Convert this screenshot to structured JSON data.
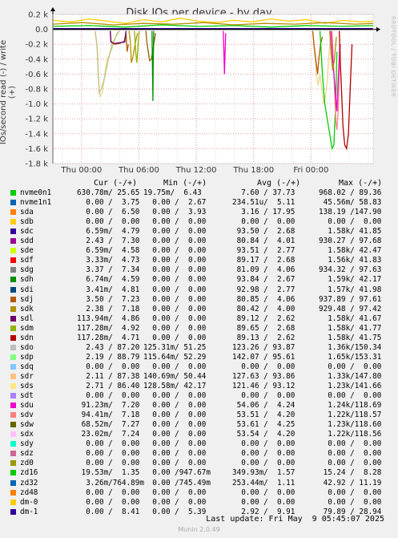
{
  "chart_data": {
    "type": "line",
    "title": "Disk IOs per device - by day",
    "ylabel": "IOs/second read (-) / write (+)",
    "side_label": "RRDTOOL / TOBI OETIKER",
    "ylim": [
      -1.8,
      0.2
    ],
    "y_ticks": [
      "0.2 k",
      "0.0",
      "-0.2 k",
      "-0.4 k",
      "-0.6 k",
      "-0.8 k",
      "-1.0 k",
      "-1.2 k",
      "-1.4 k",
      "-1.6 k",
      "-1.8 k"
    ],
    "x_ticks": [
      "Thu 00:00",
      "Thu 06:00",
      "Thu 12:00",
      "Thu 18:00",
      "Fri 00:00"
    ],
    "x_unit": "hours",
    "xlim": [
      -3,
      30.5
    ],
    "columns": [
      "Cur (-/+)",
      "Min (-/+)",
      "Avg (-/+)",
      "Max (-/+)"
    ],
    "series": [
      {
        "name": "nvme0n1",
        "color": "#00cc00",
        "cur": "630.78m/ 25.65",
        "min": "19.75m/  6.43",
        "avg": "  7.60 / 37.73",
        "max": "968.02 / 89.36"
      },
      {
        "name": "nvme1n1",
        "color": "#0066b3",
        "cur": "  0.00 /  3.75",
        "min": "  0.00 /  2.67",
        "avg": "234.51u/  5.11",
        "max": " 45.56m/ 58.83"
      },
      {
        "name": "sda",
        "color": "#ff8000",
        "cur": "  0.00 /  6.50",
        "min": "  0.00 /  3.93",
        "avg": "  3.16 / 17.95",
        "max": "138.19 /147.90"
      },
      {
        "name": "sdb",
        "color": "#ffcc00",
        "cur": "  0.00 /  0.00",
        "min": "  0.00 /  0.00",
        "avg": "  0.00 /  0.00",
        "max": "  0.00 /  0.00"
      },
      {
        "name": "sdc",
        "color": "#330099",
        "cur": "  6.59m/  4.79",
        "min": "  0.00 /  0.00",
        "avg": " 93.50 /  2.68",
        "max": "  1.58k/ 41.85"
      },
      {
        "name": "sdd",
        "color": "#990099",
        "cur": "  2.43 /  7.30",
        "min": "  0.00 /  0.00",
        "avg": " 80.84 /  4.01",
        "max": "930.27 / 97.68"
      },
      {
        "name": "sde",
        "color": "#ccff00",
        "cur": "  6.59m/  4.58",
        "min": "  0.00 /  0.00",
        "avg": " 93.51 /  2.77",
        "max": "  1.58k/ 42.47"
      },
      {
        "name": "sdf",
        "color": "#ff0000",
        "cur": "  3.33m/  4.73",
        "min": "  0.00 /  0.00",
        "avg": " 89.17 /  2.68",
        "max": "  1.56k/ 41.83"
      },
      {
        "name": "sdg",
        "color": "#808080",
        "cur": "  3.37 /  7.34",
        "min": "  0.00 /  0.00",
        "avg": " 81.09 /  4.06",
        "max": "934.32 / 97.63"
      },
      {
        "name": "sdh",
        "color": "#008f00",
        "cur": "  6.74m/  4.59",
        "min": "  0.00 /  0.00",
        "avg": " 93.84 /  2.67",
        "max": "  1.59k/ 42.17"
      },
      {
        "name": "sdi",
        "color": "#00487d",
        "cur": "  3.41m/  4.81",
        "min": "  0.00 /  0.00",
        "avg": " 92.98 /  2.77",
        "max": "  1.57k/ 41.98"
      },
      {
        "name": "sdj",
        "color": "#b35a00",
        "cur": "  3.50 /  7.23",
        "min": "  0.00 /  0.00",
        "avg": " 80.85 /  4.06",
        "max": "937.89 / 97.61"
      },
      {
        "name": "sdk",
        "color": "#b38f00",
        "cur": "  2.38 /  7.18",
        "min": "  0.00 /  0.00",
        "avg": " 80.42 /  4.00",
        "max": "929.48 / 97.42"
      },
      {
        "name": "sdl",
        "color": "#6b006b",
        "cur": "113.94m/  4.86",
        "min": "  0.00 /  0.00",
        "avg": " 89.12 /  2.62",
        "max": "  1.58k/ 41.67"
      },
      {
        "name": "sdm",
        "color": "#8fb300",
        "cur": "117.28m/  4.92",
        "min": "  0.00 /  0.00",
        "avg": " 89.65 /  2.68",
        "max": "  1.58k/ 41.77"
      },
      {
        "name": "sdn",
        "color": "#b30000",
        "cur": "117.28m/  4.71",
        "min": "  0.00 /  0.00",
        "avg": " 89.13 /  2.62",
        "max": "  1.58k/ 41.75"
      },
      {
        "name": "sdo",
        "color": "#bebebe",
        "cur": "  2.43 / 87.20",
        "min": "125.31m/ 51.25",
        "avg": "123.26 / 93.87",
        "max": "  1.36k/150.34"
      },
      {
        "name": "sdp",
        "color": "#80ff80",
        "cur": "  2.19 / 88.79",
        "min": "115.64m/ 52.29",
        "avg": "142.07 / 95.61",
        "max": "  1.65k/153.31"
      },
      {
        "name": "sdq",
        "color": "#80c9ff",
        "cur": "  0.00 /  0.00",
        "min": "  0.00 /  0.00",
        "avg": "  0.00 /  0.00",
        "max": "  0.00 /  0.00"
      },
      {
        "name": "sdr",
        "color": "#ffc080",
        "cur": "  2.11 / 87.38",
        "min": "140.69m/ 50.44",
        "avg": "127.63 / 93.86",
        "max": "  1.33k/147.80"
      },
      {
        "name": "sds",
        "color": "#ffe680",
        "cur": "  2.71 / 86.40",
        "min": "128.58m/ 42.17",
        "avg": "121.46 / 93.12",
        "max": "  1.23k/141.66"
      },
      {
        "name": "sdt",
        "color": "#aa80ff",
        "cur": "  0.00 /  0.00",
        "min": "  0.00 /  0.00",
        "avg": "  0.00 /  0.00",
        "max": "  0.00 /  0.00"
      },
      {
        "name": "sdu",
        "color": "#ee00cc",
        "cur": " 91.23m/  7.20",
        "min": "  0.00 /  0.00",
        "avg": " 54.06 /  4.24",
        "max": "  1.24k/118.69"
      },
      {
        "name": "sdv",
        "color": "#ff8080",
        "cur": " 94.41m/  7.18",
        "min": "  0.00 /  0.00",
        "avg": " 53.51 /  4.20",
        "max": "  1.22k/118.57"
      },
      {
        "name": "sdw",
        "color": "#666600",
        "cur": " 68.52m/  7.27",
        "min": "  0.00 /  0.00",
        "avg": " 53.61 /  4.25",
        "max": "  1.23k/118.60"
      },
      {
        "name": "sdx",
        "color": "#ffbfff",
        "cur": " 23.02m/  7.24",
        "min": "  0.00 /  0.00",
        "avg": " 53.54 /  4.20",
        "max": "  1.22k/118.56"
      },
      {
        "name": "sdy",
        "color": "#00ffcc",
        "cur": "  0.00 /  0.00",
        "min": "  0.00 /  0.00",
        "avg": "  0.00 /  0.00",
        "max": "  0.00 /  0.00"
      },
      {
        "name": "sdz",
        "color": "#cc6699",
        "cur": "  0.00 /  0.00",
        "min": "  0.00 /  0.00",
        "avg": "  0.00 /  0.00",
        "max": "  0.00 /  0.00"
      },
      {
        "name": "zd0",
        "color": "#999900",
        "cur": "  0.00 /  0.00",
        "min": "  0.00 /  0.00",
        "avg": "  0.00 /  0.00",
        "max": "  0.00 /  0.00"
      },
      {
        "name": "zd16",
        "color": "#00cc00",
        "cur": " 19.53m/  1.35",
        "min": "  0.00 /947.67m",
        "avg": "349.93m/  1.57",
        "max": " 15.24 /  8.28"
      },
      {
        "name": "zd32",
        "color": "#0066b3",
        "cur": "  3.26m/764.89m",
        "min": "  0.00 /745.49m",
        "avg": "253.44m/  1.11",
        "max": " 42.92 / 11.19"
      },
      {
        "name": "zd48",
        "color": "#ff8000",
        "cur": "  0.00 /  0.00",
        "min": "  0.00 /  0.00",
        "avg": "  0.00 /  0.00",
        "max": "  0.00 /  0.00"
      },
      {
        "name": "dm-0",
        "color": "#ffcc00",
        "cur": "  0.00 /  0.00",
        "min": "  0.00 /  0.00",
        "avg": "  0.00 /  0.00",
        "max": "  0.00 /  0.00"
      },
      {
        "name": "dm-1",
        "color": "#330099",
        "cur": "  0.00 /  8.41",
        "min": "  0.00 /  5.39",
        "avg": "  2.92 /  9.91",
        "max": " 79.89 / 28.94"
      }
    ],
    "traces": [
      {
        "color": "#e8d890",
        "points": [
          [
            7,
            -0.02
          ],
          [
            7.4,
            -0.3
          ],
          [
            7.6,
            -0.75
          ],
          [
            7.8,
            -0.9
          ],
          [
            8.2,
            -0.85
          ],
          [
            8.6,
            -0.6
          ],
          [
            9,
            -0.4
          ],
          [
            9.6,
            -0.3
          ],
          [
            10.2,
            -0.15
          ],
          [
            10.6,
            -0.05
          ],
          [
            11,
            -0.02
          ]
        ]
      },
      {
        "color": "#c0c080",
        "points": [
          [
            7,
            -0.02
          ],
          [
            7.3,
            -0.2
          ],
          [
            7.5,
            -0.6
          ],
          [
            7.7,
            -0.85
          ],
          [
            8,
            -0.8
          ],
          [
            8.4,
            -0.7
          ],
          [
            8.8,
            -0.55
          ],
          [
            9.2,
            -0.4
          ],
          [
            9.8,
            -0.2
          ],
          [
            10.4,
            -0.1
          ],
          [
            11,
            -0.02
          ]
        ]
      },
      {
        "color": "#b35a00",
        "points": [
          [
            9.5,
            -0.02
          ],
          [
            9.6,
            -0.15
          ],
          [
            9.8,
            -0.18
          ],
          [
            10.2,
            -0.2
          ],
          [
            11,
            -0.19
          ],
          [
            11.8,
            -0.16
          ],
          [
            12.1,
            -0.05
          ],
          [
            12.3,
            -0.3
          ],
          [
            12.5,
            -0.2
          ]
        ]
      },
      {
        "color": "#6b006b",
        "points": [
          [
            9.5,
            -0.02
          ],
          [
            9.6,
            -0.17
          ],
          [
            10.2,
            -0.19
          ],
          [
            11,
            -0.18
          ],
          [
            11.9,
            -0.17
          ],
          [
            12.1,
            -0.02
          ]
        ]
      },
      {
        "color": "#b38f00",
        "points": [
          [
            12.6,
            -0.02
          ],
          [
            12.8,
            -0.15
          ],
          [
            13,
            -0.45
          ],
          [
            13.3,
            -0.35
          ],
          [
            13.6,
            -0.2
          ],
          [
            14,
            -0.05
          ]
        ]
      },
      {
        "color": "#8f6000",
        "points": [
          [
            15.4,
            -0.02
          ],
          [
            15.6,
            -0.2
          ],
          [
            15.8,
            -0.3
          ],
          [
            16,
            -0.42
          ],
          [
            16.3,
            -0.4
          ],
          [
            16.6,
            -0.25
          ],
          [
            17,
            -0.05
          ]
        ]
      },
      {
        "color": "#008f00",
        "points": [
          [
            16.4,
            -0.02
          ],
          [
            16.5,
            -0.6
          ],
          [
            16.55,
            -0.96
          ],
          [
            16.6,
            -0.5
          ],
          [
            16.7,
            -0.02
          ]
        ]
      },
      {
        "color": "#8fb300",
        "points": [
          [
            13.5,
            -0.02
          ],
          [
            13.7,
            -0.3
          ],
          [
            13.9,
            -0.45
          ],
          [
            14.1,
            -0.2
          ],
          [
            14.3,
            -0.02
          ]
        ]
      },
      {
        "color": "#ee00cc",
        "points": [
          [
            28.2,
            -0.02
          ],
          [
            28.3,
            -0.3
          ],
          [
            28.4,
            -0.6
          ],
          [
            28.5,
            -0.3
          ],
          [
            28.6,
            -0.05
          ]
        ]
      },
      {
        "color": "#e8d890",
        "points": [
          [
            43,
            -0.02
          ],
          [
            43.3,
            -0.3
          ],
          [
            43.6,
            -0.6
          ],
          [
            43.9,
            -0.75
          ],
          [
            44.2,
            -0.6
          ],
          [
            44.5,
            -0.8
          ],
          [
            44.8,
            -1.0
          ],
          [
            45.1,
            -0.9
          ],
          [
            45.4,
            -0.7
          ],
          [
            45.7,
            -0.3
          ],
          [
            46,
            -0.05
          ]
        ]
      },
      {
        "color": "#b35a00",
        "points": [
          [
            43,
            -0.02
          ],
          [
            43.2,
            -0.2
          ],
          [
            43.5,
            -0.4
          ],
          [
            43.8,
            -0.6
          ],
          [
            44,
            -0.4
          ],
          [
            44.3,
            -0.2
          ],
          [
            44.6,
            -0.1
          ]
        ]
      },
      {
        "color": "#00cc00",
        "points": [
          [
            44.2,
            -0.02
          ],
          [
            44.6,
            -0.6
          ],
          [
            45,
            -1.0
          ],
          [
            45.4,
            -1.2
          ],
          [
            45.8,
            -1.4
          ],
          [
            46.2,
            -1.6
          ],
          [
            46.5,
            -1.55
          ],
          [
            46.8,
            -1.0
          ],
          [
            47,
            -0.3
          ]
        ]
      },
      {
        "color": "#ff8080",
        "points": [
          [
            46.2,
            -0.02
          ],
          [
            46.4,
            -0.4
          ],
          [
            46.6,
            -0.8
          ],
          [
            46.8,
            -1.2
          ],
          [
            47,
            -1.35
          ],
          [
            47.2,
            -1.1
          ],
          [
            47.4,
            -0.6
          ],
          [
            47.6,
            -0.2
          ]
        ]
      },
      {
        "color": "#ee00cc",
        "points": [
          [
            46,
            -0.02
          ],
          [
            46.2,
            -0.3
          ],
          [
            46.5,
            -0.6
          ],
          [
            46.8,
            -0.9
          ],
          [
            47,
            -1.1
          ],
          [
            47.2,
            -0.7
          ],
          [
            47.5,
            -0.2
          ]
        ]
      },
      {
        "color": "#b30000",
        "points": [
          [
            47.4,
            -0.02
          ],
          [
            47.6,
            -0.5
          ],
          [
            47.8,
            -0.9
          ],
          [
            48,
            -1.3
          ],
          [
            48.3,
            -1.55
          ],
          [
            48.6,
            -1.6
          ],
          [
            48.9,
            -1.4
          ],
          [
            49.2,
            -0.8
          ],
          [
            49.5,
            -0.2
          ]
        ]
      },
      {
        "color": "#b38f00",
        "points": [
          [
            45.8,
            -0.02
          ],
          [
            46,
            -0.3
          ],
          [
            46.3,
            -0.55
          ],
          [
            46.6,
            -0.4
          ],
          [
            46.9,
            -0.1
          ]
        ]
      },
      {
        "color": "#00cc00",
        "points": [
          [
            0,
            0.04
          ],
          [
            6,
            0.05
          ],
          [
            12,
            0.03
          ],
          [
            18,
            0.06
          ],
          [
            24,
            0.04
          ],
          [
            30,
            0.05
          ],
          [
            36,
            0.03
          ],
          [
            42,
            0.05
          ],
          [
            48,
            0.04
          ],
          [
            53,
            0.05
          ]
        ]
      },
      {
        "color": "#ffcc00",
        "points": [
          [
            0,
            0.12
          ],
          [
            3,
            0.1
          ],
          [
            6,
            0.14
          ],
          [
            9,
            0.11
          ],
          [
            12,
            0.08
          ],
          [
            15,
            0.13
          ],
          [
            18,
            0.1
          ],
          [
            21,
            0.15
          ],
          [
            24,
            0.11
          ],
          [
            27,
            0.09
          ],
          [
            30,
            0.12
          ],
          [
            33,
            0.1
          ],
          [
            36,
            0.14
          ],
          [
            39,
            0.11
          ],
          [
            42,
            0.13
          ],
          [
            45,
            0.08
          ],
          [
            48,
            0.12
          ],
          [
            51,
            0.1
          ],
          [
            53,
            0.11
          ]
        ]
      },
      {
        "color": "#b38f00",
        "points": [
          [
            0,
            0.07
          ],
          [
            5,
            0.09
          ],
          [
            10,
            0.06
          ],
          [
            15,
            0.08
          ],
          [
            20,
            0.07
          ],
          [
            25,
            0.09
          ],
          [
            30,
            0.06
          ],
          [
            35,
            0.08
          ],
          [
            40,
            0.07
          ],
          [
            45,
            0.09
          ],
          [
            50,
            0.07
          ],
          [
            53,
            0.08
          ]
        ]
      },
      {
        "color": "#330099",
        "points": [
          [
            0,
            0.01
          ],
          [
            53,
            0.01
          ]
        ]
      },
      {
        "color": "#000000",
        "points": [
          [
            0,
            0.0
          ],
          [
            53,
            0.0
          ]
        ]
      }
    ],
    "trace_xlim": [
      0,
      53
    ]
  },
  "footer": {
    "last_update": "Last update: Fri May  9 05:45:07 2025",
    "version": "Munin 2.0.49"
  }
}
